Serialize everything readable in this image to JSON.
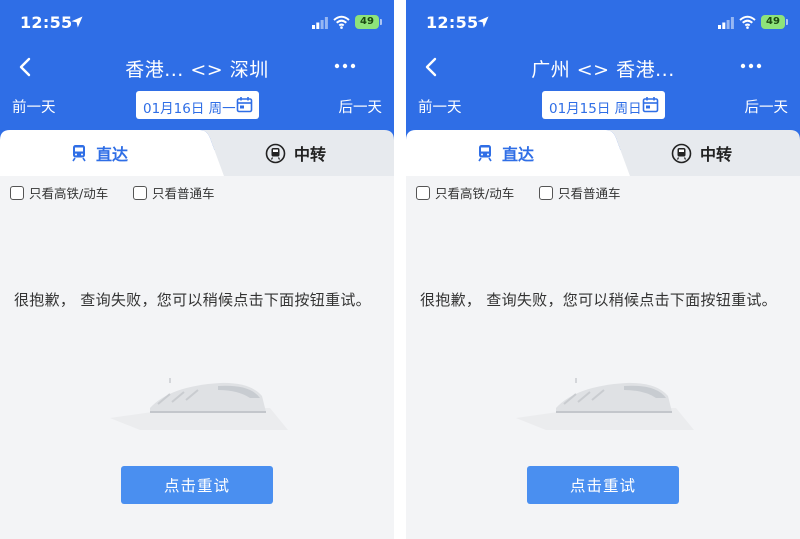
{
  "screens": [
    {
      "status": {
        "time": "12:55",
        "battery": "49"
      },
      "nav": {
        "title": "香港... <> 深圳"
      },
      "date_bar": {
        "prev": "前一天",
        "date": "01月16日 周一",
        "next": "后一天"
      },
      "tabs": {
        "direct": "直达",
        "transfer": "中转"
      },
      "filters": {
        "high_speed": "只看高铁/动车",
        "normal": "只看普通车"
      },
      "error": {
        "message": "很抱歉， 查询失败，您可以稍候点击下面按钮重试。"
      },
      "retry": {
        "label": "点击重试"
      }
    },
    {
      "status": {
        "time": "12:55",
        "battery": "49"
      },
      "nav": {
        "title": "广州 <> 香港..."
      },
      "date_bar": {
        "prev": "前一天",
        "date": "01月15日 周日",
        "next": "后一天"
      },
      "tabs": {
        "direct": "直达",
        "transfer": "中转"
      },
      "filters": {
        "high_speed": "只看高铁/动车",
        "normal": "只看普通车"
      },
      "error": {
        "message": "很抱歉， 查询失败，您可以稍候点击下面按钮重试。"
      },
      "retry": {
        "label": "点击重试"
      }
    }
  ],
  "colors": {
    "primary": "#2f6ee6",
    "button": "#4a8ff0",
    "battery": "#8ee37a"
  },
  "icons": [
    "location-arrow-icon",
    "signal-icon",
    "wifi-icon",
    "back-icon",
    "more-icon",
    "calendar-icon",
    "train-icon",
    "transfer-icon",
    "train-illustration"
  ]
}
